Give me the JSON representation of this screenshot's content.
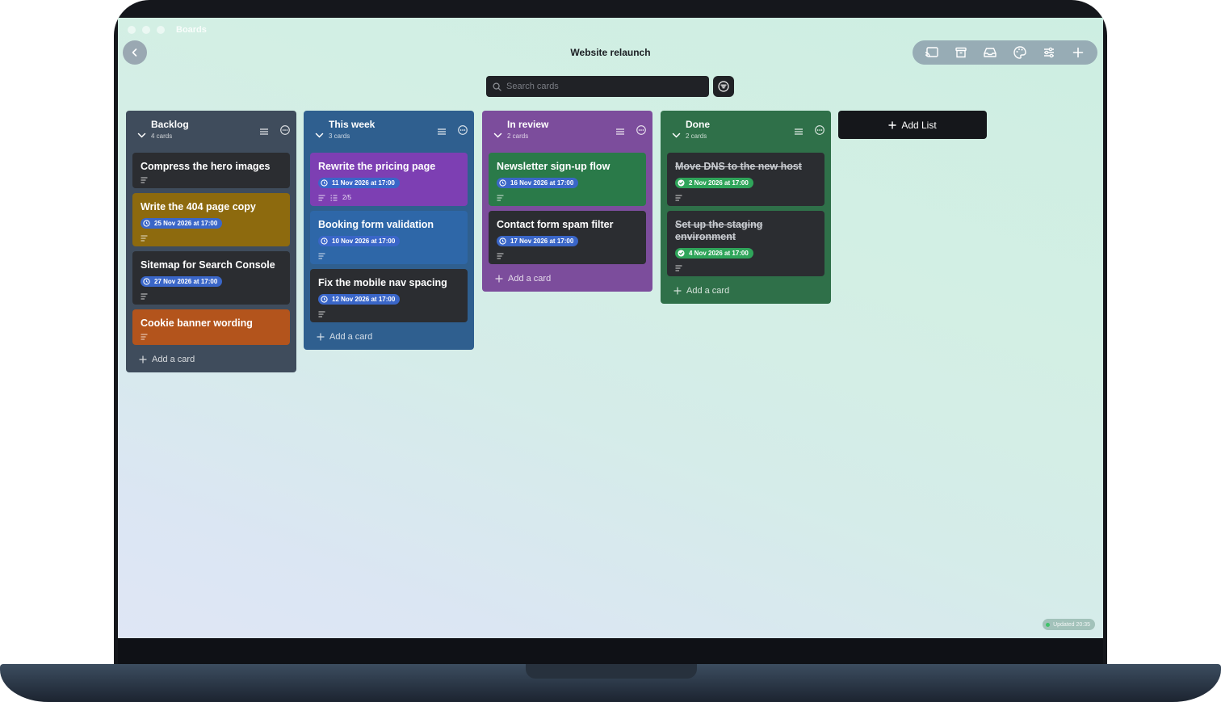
{
  "window": {
    "title": "Boards"
  },
  "board": {
    "title": "Website relaunch"
  },
  "toolbar": {
    "icons": [
      "cast-icon",
      "archive-icon",
      "inbox-icon",
      "palette-icon",
      "sliders-icon",
      "plus-icon"
    ]
  },
  "search": {
    "placeholder": "Search cards"
  },
  "add_card_label": "Add a card",
  "add_list_label": "Add List",
  "lists": [
    {
      "title": "Backlog",
      "count": "4 cards",
      "color": "#3f4c5c",
      "cards": [
        {
          "title": "Compress the hero images",
          "color": "#2b2d31"
        },
        {
          "title": "Write the 404 page copy",
          "color": "#8d6a0e",
          "due": "25 Nov 2026 at 17:00"
        },
        {
          "title": "Sitemap for Search Console",
          "color": "#2b2d31",
          "due": "27 Nov 2026 at 17:00"
        },
        {
          "title": "Cookie banner wording",
          "color": "#b3541c"
        }
      ]
    },
    {
      "title": "This week",
      "count": "3 cards",
      "color": "#2f5f8f",
      "cards": [
        {
          "title": "Rewrite the pricing page",
          "color": "#7d3fb3",
          "due": "11 Nov 2026 at 17:00",
          "checklist": "2/5"
        },
        {
          "title": "Booking form validation",
          "color": "#2e67a8",
          "due": "10 Nov 2026 at 17:00"
        },
        {
          "title": "Fix the mobile nav spacing",
          "color": "#2b2d31",
          "due": "12 Nov 2026 at 17:00"
        }
      ]
    },
    {
      "title": "In review",
      "count": "2 cards",
      "color": "#7c4d9c",
      "cards": [
        {
          "title": "Newsletter sign-up flow",
          "color": "#2a7a49",
          "due": "16 Nov 2026 at 17:00"
        },
        {
          "title": "Contact form spam filter",
          "color": "#2b2d31",
          "due": "17 Nov 2026 at 17:00"
        }
      ]
    },
    {
      "title": "Done",
      "count": "2 cards",
      "color": "#2f7049",
      "cards": [
        {
          "title": "Move DNS to the new host",
          "color": "#2b2d31",
          "due": "2 Nov 2026 at 17:00",
          "done": true
        },
        {
          "title": "Set up the staging environment",
          "color": "#2b2d31",
          "due": "4 Nov 2026 at 17:00",
          "done": true
        }
      ]
    }
  ],
  "status": {
    "updated": "Updated 20:35"
  }
}
